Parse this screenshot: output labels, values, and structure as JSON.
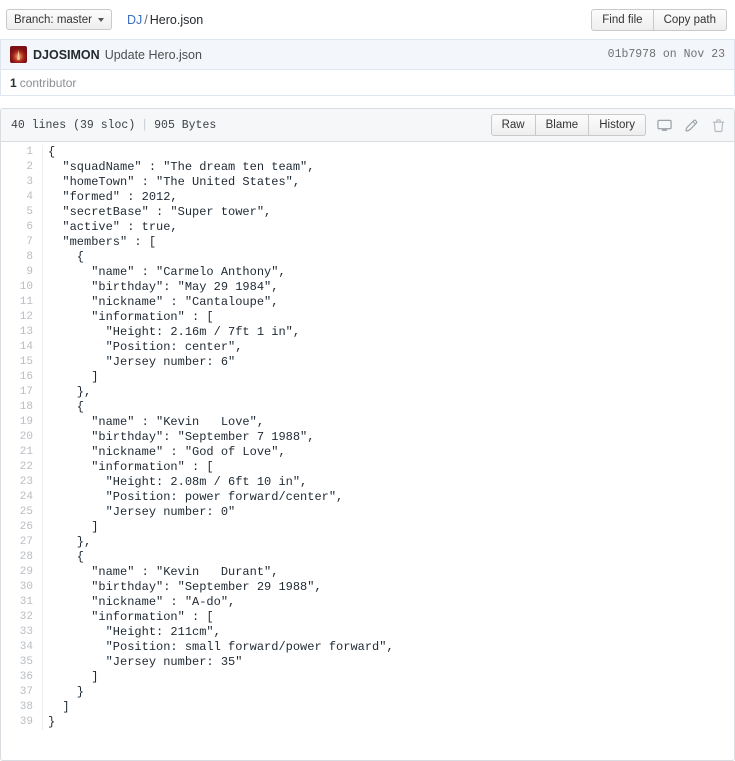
{
  "toolbar": {
    "branch_label": "Branch: master",
    "branch_caret_icon": "chevron-down-icon",
    "breadcrumb_repo": "DJ",
    "breadcrumb_sep": "/",
    "breadcrumb_file": "Hero.json",
    "find_file_label": "Find file",
    "copy_path_label": "Copy path"
  },
  "commit": {
    "avatar_icon": "user-avatar",
    "author": "DJOSIMON",
    "message": "Update Hero.json",
    "hash": "01b7978",
    "date": "on Nov 23",
    "meta": "01b7978 on Nov 23"
  },
  "contributors": {
    "count": "1",
    "label": "contributor"
  },
  "file_header": {
    "lines": "40 lines (39 sloc)",
    "divider": "|",
    "size": "905 Bytes",
    "raw_label": "Raw",
    "blame_label": "Blame",
    "history_label": "History",
    "desktop_icon": "desktop-download-icon",
    "edit_icon": "pencil-icon",
    "delete_icon": "trash-icon"
  },
  "code": {
    "language": "json",
    "line_count": 39,
    "lines": [
      "{",
      "  \"squadName\" : \"The dream ten team\",",
      "  \"homeTown\" : \"The United States\",",
      "  \"formed\" : 2012,",
      "  \"secretBase\" : \"Super tower\",",
      "  \"active\" : true,",
      "  \"members\" : [",
      "    {",
      "      \"name\" : \"Carmelo Anthony\",",
      "      \"birthday\": \"May 29 1984\",",
      "      \"nickname\" : \"Cantaloupe\",",
      "      \"information\" : [",
      "        \"Height: 2.16m / 7ft 1 in\",",
      "        \"Position: center\",",
      "        \"Jersey number: 6\"",
      "      ]",
      "    },",
      "    {",
      "      \"name\" : \"Kevin   Love\",",
      "      \"birthday\": \"September 7 1988\",",
      "      \"nickname\" : \"God of Love\",",
      "      \"information\" : [",
      "        \"Height: 2.08m / 6ft 10 in\",",
      "        \"Position: power forward/center\",",
      "        \"Jersey number: 0\"",
      "      ]",
      "    },",
      "    {",
      "      \"name\" : \"Kevin   Durant\",",
      "      \"birthday\": \"September 29 1988\",",
      "      \"nickname\" : \"A-do\",",
      "      \"information\" : [",
      "        \"Height: 211cm\",",
      "        \"Position: small forward/power forward\",",
      "        \"Jersey number: 35\"",
      "      ]",
      "    }",
      "  ]",
      "}"
    ]
  },
  "colors": {
    "link": "#3b6fbd",
    "commit_bar_bg": "#f3f7fc",
    "file_header_bg": "#f5f7f9",
    "border": "#d9dde2",
    "line_number": "#b9bdc2",
    "code_text": "#1f2933",
    "avatar": "#7b1015"
  }
}
